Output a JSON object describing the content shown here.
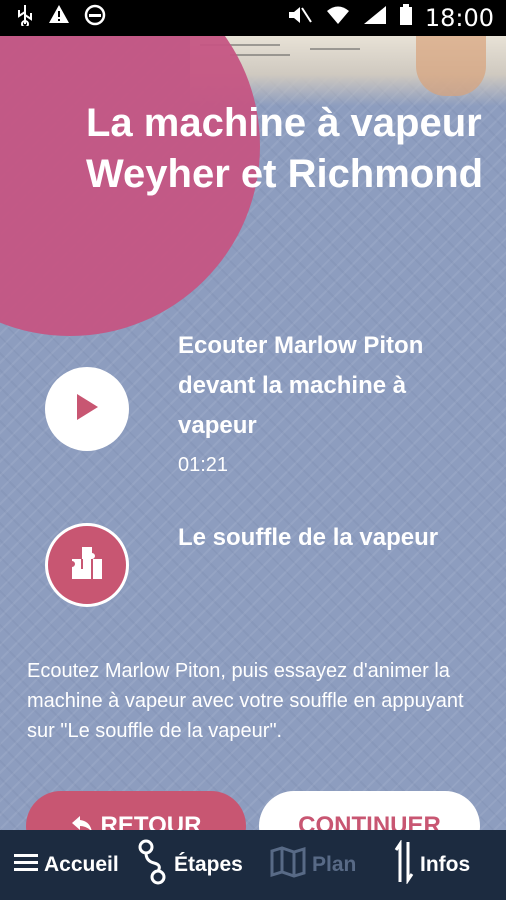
{
  "status_bar": {
    "time": "18:00",
    "left_icons": [
      "usb-icon",
      "warning-icon",
      "blocked-icon"
    ],
    "right_icons": [
      "mute-icon",
      "wifi-icon",
      "signal-icon",
      "battery-icon"
    ]
  },
  "page": {
    "title": "La machine à vapeur Weyher et Richmond"
  },
  "items": [
    {
      "title": "Ecouter Marlow Piton devant la machine à vapeur",
      "duration": "01:21",
      "icon": "play-icon"
    },
    {
      "title": "Le souffle de la vapeur",
      "icon": "puzzle-icon"
    }
  ],
  "description": "Ecoutez Marlow Piton, puis essayez d'animer la machine à vapeur avec votre souffle en appuyant sur \"Le souffle de la vapeur\".",
  "buttons": {
    "back_label": "RETOUR",
    "continue_label": "CONTINUER"
  },
  "nav": {
    "items": [
      {
        "label": "Accueil",
        "icon": "menu-icon"
      },
      {
        "label": "Étapes",
        "icon": "route-icon"
      },
      {
        "label": "Plan",
        "icon": "map-icon",
        "disabled": true
      },
      {
        "label": "Infos",
        "icon": "updown-arrows-icon"
      }
    ]
  },
  "colors": {
    "accent": "#c85672",
    "blob": "#c55583",
    "background": "#8d9dbf",
    "nav_background": "#1c2b40"
  }
}
